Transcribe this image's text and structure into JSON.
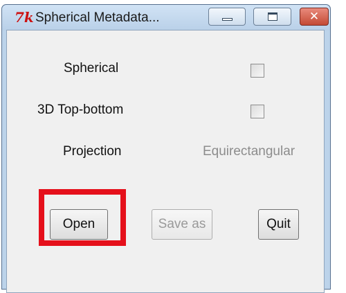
{
  "window": {
    "title": "Spherical Metadata...",
    "app_icon": "tk-feather-icon",
    "controls": {
      "minimize_icon": "minimize-icon",
      "maximize_icon": "maximize-icon",
      "close_icon": "close-icon",
      "close_glyph": "✕"
    }
  },
  "fields": {
    "spherical": {
      "label": "Spherical",
      "checked": false
    },
    "top_bottom": {
      "label": "3D Top-bottom",
      "checked": false
    },
    "projection": {
      "label": "Projection",
      "value": "Equirectangular"
    }
  },
  "buttons": {
    "open": "Open",
    "save_as": "Save as",
    "quit": "Quit"
  },
  "colors": {
    "highlight": "#e5101b",
    "disabled_text": "#8c8c8c",
    "window_frame": "#bcd3ea"
  }
}
